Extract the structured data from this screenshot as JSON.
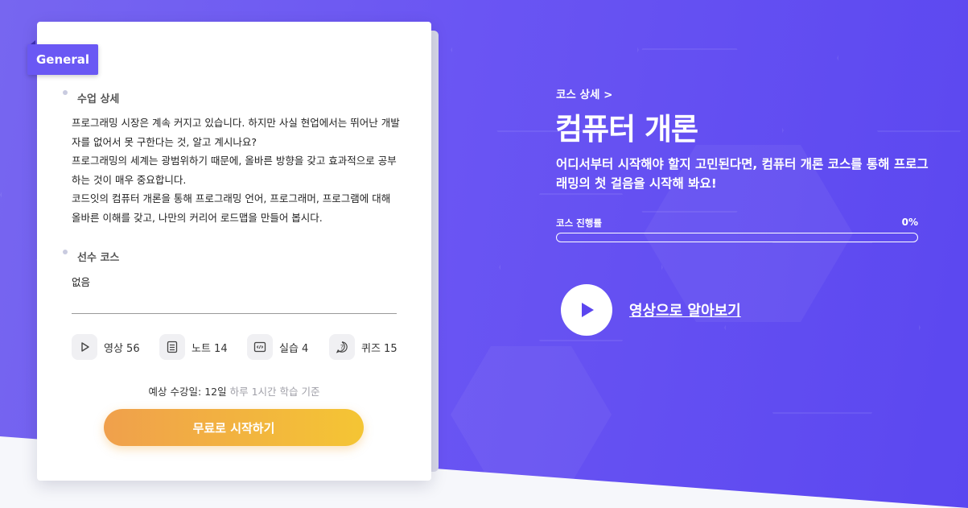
{
  "card": {
    "tag": "General",
    "description_title": "수업 상세",
    "description": [
      "프로그래밍 시장은 계속 커지고 있습니다. 하지만 사실 현업에서는 뛰어난 개발자를 없어서 못 구한다는 것, 알고 계시나요?",
      "프로그래밍의 세계는 광범위하기 때문에, 올바른 방향을 갖고 효과적으로 공부하는 것이 매우 중요합니다.",
      "코드잇의 컴퓨터 개론을 통해 프로그래밍 언어, 프로그래머, 프로그램에 대해 올바른 이해를 갖고, 나만의 커리어 로드맵을 만들어 봅시다."
    ],
    "prereq_title": "선수 코스",
    "prereq_value": "없음",
    "stats": [
      {
        "icon": "play-icon",
        "label": "영상 56"
      },
      {
        "icon": "note-icon",
        "label": "노트 14"
      },
      {
        "icon": "code-icon",
        "label": "실습 4"
      },
      {
        "icon": "quiz-icon",
        "label": "퀴즈 15"
      }
    ],
    "duration_main": "예상 수강일: 12일",
    "duration_note": "하루 1시간 학습 기준",
    "start_button": "무료로 시작하기"
  },
  "course": {
    "breadcrumb": "코스 상세 >",
    "title": "컴퓨터 개론",
    "subtitle": "어디서부터 시작해야 할지 고민된다면, 컴퓨터 개론 코스를 통해 프로그래밍의 첫 걸음을 시작해 봐요!",
    "progress_label": "코스 진행률",
    "progress_value": "0%",
    "progress_fraction": 0,
    "video_link": "영상으로 알아보기"
  },
  "colors": {
    "hero": "#6a55f3",
    "accent": "#6a58f4",
    "button_start": "#f0a04c",
    "button_end": "#f4c534"
  }
}
